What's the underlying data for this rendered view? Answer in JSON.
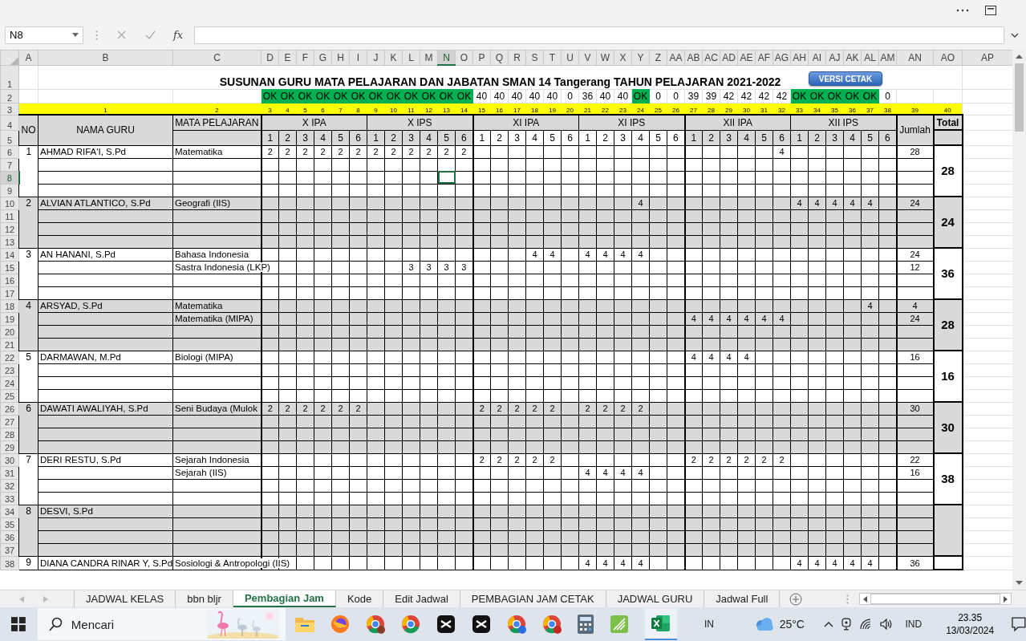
{
  "formula_bar": {
    "name_box": "N8",
    "fx": "fx"
  },
  "sheet": {
    "title": "SUSUNAN GURU MATA PELAJARAN DAN JABATAN SMAN 14 Tangerang TAHUN PELAJARAN 2021-2022",
    "button_label": "VERSI CETAK",
    "column_headers": [
      {
        "label": "A",
        "selected": false
      },
      {
        "label": "B",
        "selected": false
      },
      {
        "label": "C",
        "selected": false
      },
      {
        "label": "D",
        "selected": false
      },
      {
        "label": "E",
        "selected": false
      },
      {
        "label": "F",
        "selected": false
      },
      {
        "label": "G",
        "selected": false
      },
      {
        "label": "H",
        "selected": false
      },
      {
        "label": "I",
        "selected": false
      },
      {
        "label": "J",
        "selected": false
      },
      {
        "label": "K",
        "selected": false
      },
      {
        "label": "L",
        "selected": false
      },
      {
        "label": "M",
        "selected": false
      },
      {
        "label": "N",
        "selected": true
      },
      {
        "label": "O",
        "selected": false
      },
      {
        "label": "P",
        "selected": false
      },
      {
        "label": "Q",
        "selected": false
      },
      {
        "label": "R",
        "selected": false
      },
      {
        "label": "S",
        "selected": false
      },
      {
        "label": "T",
        "selected": false
      },
      {
        "label": "U",
        "selected": false
      },
      {
        "label": "V",
        "selected": false
      },
      {
        "label": "W",
        "selected": false
      },
      {
        "label": "X",
        "selected": false
      },
      {
        "label": "Y",
        "selected": false
      },
      {
        "label": "Z",
        "selected": false
      },
      {
        "label": "AA",
        "selected": false
      },
      {
        "label": "AB",
        "selected": false
      },
      {
        "label": "AC",
        "selected": false
      },
      {
        "label": "AD",
        "selected": false
      },
      {
        "label": "AE",
        "selected": false
      },
      {
        "label": "AF",
        "selected": false
      },
      {
        "label": "AG",
        "selected": false
      },
      {
        "label": "AH",
        "selected": false
      },
      {
        "label": "AI",
        "selected": false
      },
      {
        "label": "AJ",
        "selected": false
      },
      {
        "label": "AK",
        "selected": false
      },
      {
        "label": "AL",
        "selected": false
      },
      {
        "label": "AM",
        "selected": false
      },
      {
        "label": "AN",
        "selected": false
      },
      {
        "label": "AO",
        "selected": false
      },
      {
        "label": "AP",
        "selected": false
      }
    ],
    "row_headers": [
      {
        "label": "1",
        "selected": false
      },
      {
        "label": "2",
        "selected": false
      },
      {
        "label": "3",
        "selected": false
      },
      {
        "label": "4",
        "selected": false
      },
      {
        "label": "5",
        "selected": false
      },
      {
        "label": "6",
        "selected": false
      },
      {
        "label": "7",
        "selected": false
      },
      {
        "label": "8",
        "selected": true
      },
      {
        "label": "9",
        "selected": false
      },
      {
        "label": "10",
        "selected": false
      },
      {
        "label": "11",
        "selected": false
      },
      {
        "label": "12",
        "selected": false
      },
      {
        "label": "13",
        "selected": false
      },
      {
        "label": "14",
        "selected": false
      },
      {
        "label": "15",
        "selected": false
      },
      {
        "label": "16",
        "selected": false
      },
      {
        "label": "17",
        "selected": false
      },
      {
        "label": "18",
        "selected": false
      },
      {
        "label": "19",
        "selected": false
      },
      {
        "label": "20",
        "selected": false
      },
      {
        "label": "21",
        "selected": false
      },
      {
        "label": "22",
        "selected": false
      },
      {
        "label": "23",
        "selected": false
      },
      {
        "label": "24",
        "selected": false
      },
      {
        "label": "25",
        "selected": false
      },
      {
        "label": "26",
        "selected": false
      },
      {
        "label": "27",
        "selected": false
      },
      {
        "label": "28",
        "selected": false
      },
      {
        "label": "29",
        "selected": false
      },
      {
        "label": "30",
        "selected": false
      },
      {
        "label": "31",
        "selected": false
      },
      {
        "label": "32",
        "selected": false
      },
      {
        "label": "33",
        "selected": false
      },
      {
        "label": "34",
        "selected": false
      },
      {
        "label": "35",
        "selected": false
      },
      {
        "label": "36",
        "selected": false
      },
      {
        "label": "37",
        "selected": false
      },
      {
        "label": "38",
        "selected": false
      }
    ],
    "status": [
      {
        "text": "OK",
        "ok": true
      },
      {
        "text": "OK",
        "ok": true
      },
      {
        "text": "OK",
        "ok": true
      },
      {
        "text": "OK",
        "ok": true
      },
      {
        "text": "OK",
        "ok": true
      },
      {
        "text": "OK",
        "ok": true
      },
      {
        "text": "OK",
        "ok": true
      },
      {
        "text": "OK",
        "ok": true
      },
      {
        "text": "OK",
        "ok": true
      },
      {
        "text": "OK",
        "ok": true
      },
      {
        "text": "OK",
        "ok": true
      },
      {
        "text": "OK",
        "ok": true
      },
      {
        "text": "40",
        "ok": false
      },
      {
        "text": "40",
        "ok": false
      },
      {
        "text": "40",
        "ok": false
      },
      {
        "text": "40",
        "ok": false
      },
      {
        "text": "40",
        "ok": false
      },
      {
        "text": "0",
        "ok": false
      },
      {
        "text": "36",
        "ok": false
      },
      {
        "text": "40",
        "ok": false
      },
      {
        "text": "40",
        "ok": false
      },
      {
        "text": "OK",
        "ok": true
      },
      {
        "text": "0",
        "ok": false
      },
      {
        "text": "0",
        "ok": false
      },
      {
        "text": "39",
        "ok": false
      },
      {
        "text": "39",
        "ok": false
      },
      {
        "text": "42",
        "ok": false
      },
      {
        "text": "42",
        "ok": false
      },
      {
        "text": "42",
        "ok": false
      },
      {
        "text": "42",
        "ok": false
      },
      {
        "text": "OK",
        "ok": true
      },
      {
        "text": "OK",
        "ok": true
      },
      {
        "text": "OK",
        "ok": true
      },
      {
        "text": "OK",
        "ok": true
      },
      {
        "text": "OK",
        "ok": true
      },
      {
        "text": "0",
        "ok": false
      }
    ],
    "column_numbers": [
      "1",
      "2",
      "3",
      "4",
      "5",
      "6",
      "7",
      "8",
      "9",
      "10",
      "11",
      "12",
      "13",
      "14",
      "15",
      "16",
      "17",
      "18",
      "19",
      "20",
      "21",
      "22",
      "23",
      "24",
      "25",
      "26",
      "27",
      "28",
      "29",
      "30",
      "31",
      "32",
      "33",
      "34",
      "35",
      "36",
      "37",
      "38",
      "39",
      "40"
    ],
    "header": {
      "no": "NO",
      "name": "NAMA GURU",
      "subject": "MATA PELAJARAN",
      "sum": "Jumlah",
      "total": "Total",
      "classes": [
        {
          "label": "X IPA",
          "shaded": true,
          "columns": [
            "1",
            "2",
            "3",
            "4",
            "5",
            "6"
          ]
        },
        {
          "label": "X IPS",
          "shaded": true,
          "columns": [
            "1",
            "2",
            "3",
            "4",
            "5",
            "6"
          ]
        },
        {
          "label": "XI IPA",
          "shaded": false,
          "columns": [
            "1",
            "2",
            "3",
            "4",
            "5",
            "6"
          ]
        },
        {
          "label": "XI IPS",
          "shaded": false,
          "columns": [
            "1",
            "2",
            "3",
            "4",
            "5",
            "6"
          ]
        },
        {
          "label": "XII IPA",
          "shaded": true,
          "columns": [
            "1",
            "2",
            "3",
            "4",
            "5",
            "6"
          ]
        },
        {
          "label": "XII IPS",
          "shaded": true,
          "columns": [
            "1",
            "2",
            "3",
            "4",
            "5",
            "6"
          ]
        }
      ]
    },
    "teachers": [
      {
        "no": "1",
        "name": "AHMAD RIFA'I, S.Pd",
        "shaded": false,
        "total": "28",
        "lines": [
          {
            "subject": "Matematika",
            "sum": "28",
            "hours": {
              "3": "2",
              "4": "2",
              "5": "2",
              "6": "2",
              "7": "2",
              "8": "2",
              "9": "2",
              "10": "2",
              "11": "2",
              "12": "2",
              "13": "2",
              "14": "2",
              "32": "4"
            }
          }
        ]
      },
      {
        "no": "2",
        "name": "ALVIAN ATLANTICO, S.Pd",
        "shaded": true,
        "total": "24",
        "lines": [
          {
            "subject": "Geografi (IIS)",
            "sum": "24",
            "hours": {
              "24": "4",
              "33": "4",
              "34": "4",
              "35": "4",
              "36": "4",
              "37": "4"
            }
          }
        ]
      },
      {
        "no": "3",
        "name": "AN HANANI, S.Pd",
        "shaded": false,
        "total": "36",
        "lines": [
          {
            "subject": "Bahasa Indonesia",
            "sum": "24",
            "hours": {
              "18": "4",
              "19": "4",
              "21": "4",
              "22": "4",
              "23": "4",
              "24": "4"
            }
          },
          {
            "subject": "Sastra Indonesia (LKP)",
            "sum": "12",
            "hours": {
              "11": "3",
              "12": "3",
              "13": "3",
              "14": "3"
            }
          }
        ]
      },
      {
        "no": "4",
        "name": "ARSYAD, S.Pd",
        "shaded": true,
        "total": "28",
        "lines": [
          {
            "subject": "Matematika",
            "sum": "4",
            "hours": {
              "37": "4"
            }
          },
          {
            "subject": "Matematika (MIPA)",
            "sum": "24",
            "hours": {
              "27": "4",
              "28": "4",
              "29": "4",
              "30": "4",
              "31": "4",
              "32": "4"
            }
          }
        ]
      },
      {
        "no": "5",
        "name": "DARMAWAN, M.Pd",
        "shaded": false,
        "total": "16",
        "lines": [
          {
            "subject": "Biologi (MIPA)",
            "sum": "16",
            "hours": {
              "27": "4",
              "28": "4",
              "29": "4",
              "30": "4"
            }
          }
        ]
      },
      {
        "no": "6",
        "name": "DAWATI AWALIYAH, S.Pd",
        "shaded": true,
        "total": "30",
        "lines": [
          {
            "subject": "Seni Budaya (Mulok",
            "sum": "30",
            "hours": {
              "3": "2",
              "4": "2",
              "5": "2",
              "6": "2",
              "7": "2",
              "8": "2",
              "15": "2",
              "16": "2",
              "17": "2",
              "18": "2",
              "19": "2",
              "21": "2",
              "22": "2",
              "23": "2",
              "24": "2"
            }
          }
        ]
      },
      {
        "no": "7",
        "name": "DERI RESTU, S.Pd",
        "shaded": false,
        "total": "38",
        "lines": [
          {
            "subject": "Sejarah Indonesia",
            "sum": "22",
            "hours": {
              "15": "2",
              "16": "2",
              "17": "2",
              "18": "2",
              "19": "2",
              "27": "2",
              "28": "2",
              "29": "2",
              "30": "2",
              "31": "2",
              "32": "2"
            }
          },
          {
            "subject": "Sejarah (IIS)",
            "sum": "16",
            "hours": {
              "21": "4",
              "22": "4",
              "23": "4",
              "24": "4"
            }
          }
        ]
      },
      {
        "no": "8",
        "name": "DESVI, S.Pd",
        "shaded": true
      },
      {
        "no": "9",
        "name": "DIANA CANDRA RINAR Y, S.Pd",
        "shaded": false,
        "lines": [
          {
            "subject": "Sosiologi & Antropologi (IIS)",
            "sum": "36",
            "hours": {
              "21": "4",
              "22": "4",
              "23": "4",
              "24": "4",
              "33": "4",
              "34": "4",
              "35": "4",
              "36": "4",
              "37": "4"
            }
          }
        ]
      }
    ]
  },
  "sheet_tabs": [
    {
      "label": "JADWAL KELAS",
      "selected": false
    },
    {
      "label": "bbn bljr",
      "selected": false
    },
    {
      "label": "Pembagian Jam",
      "selected": true
    },
    {
      "label": "Kode",
      "selected": false
    },
    {
      "label": "Edit Jadwal",
      "selected": false
    },
    {
      "label": "PEMBAGIAN JAM CETAK",
      "selected": false
    },
    {
      "label": "JADWAL GURU",
      "selected": false
    },
    {
      "label": "Jadwal Full",
      "selected": false
    }
  ],
  "taskbar": {
    "search_placeholder": "Mencari",
    "keyboard": "IN",
    "temperature": "25°C",
    "language": "IND",
    "time": "23.35",
    "date": "13/03/2024"
  }
}
